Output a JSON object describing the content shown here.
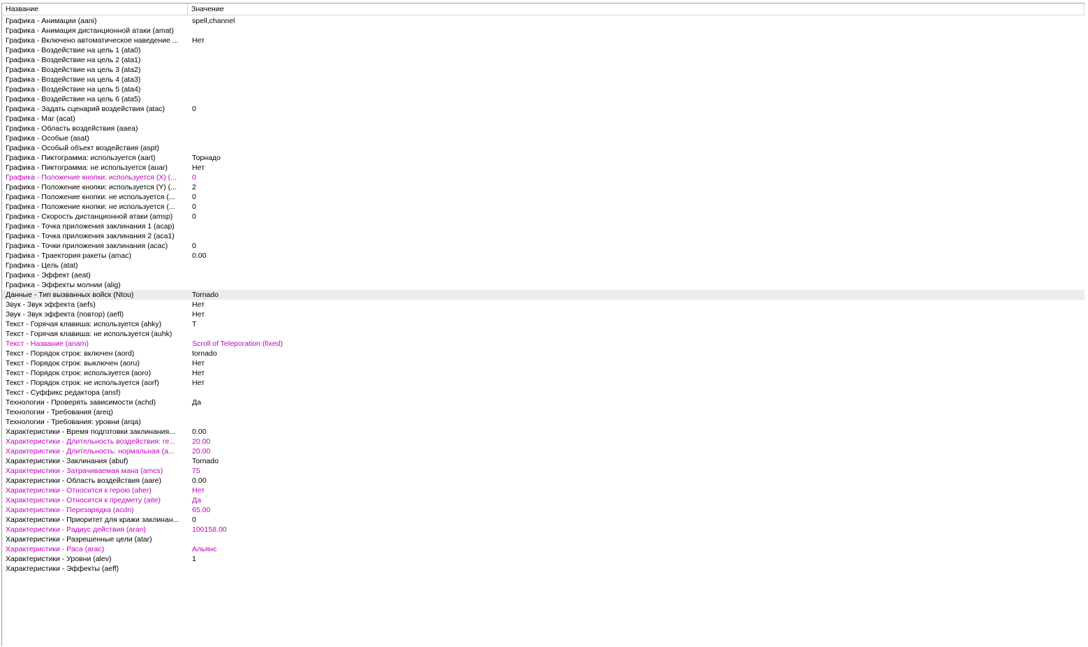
{
  "columns": {
    "name": "Название",
    "value": "Значение"
  },
  "colors": {
    "modified_text": "#c000c0",
    "selected_row_bg": "#ececec"
  },
  "rows": [
    {
      "name": "Графика - Анимации (aani)",
      "value": "spell,channel",
      "modified": false
    },
    {
      "name": "Графика - Анимация дистанционной атаки (amat)",
      "value": "",
      "modified": false
    },
    {
      "name": "Графика - Включено автоматическое наведение ...",
      "value": "Нет",
      "modified": false
    },
    {
      "name": "Графика - Воздействие на цель 1 (ata0)",
      "value": "",
      "modified": false
    },
    {
      "name": "Графика - Воздействие на цель 2 (ata1)",
      "value": "",
      "modified": false
    },
    {
      "name": "Графика - Воздействие на цель 3 (ata2)",
      "value": "",
      "modified": false
    },
    {
      "name": "Графика - Воздействие на цель 4 (ata3)",
      "value": "",
      "modified": false
    },
    {
      "name": "Графика - Воздействие на цель 5 (ata4)",
      "value": "",
      "modified": false
    },
    {
      "name": "Графика - Воздействие на цель 6 (ata5)",
      "value": "",
      "modified": false
    },
    {
      "name": "Графика - Задать сценарий воздействия (atac)",
      "value": "0",
      "modified": false
    },
    {
      "name": "Графика - Маг (acat)",
      "value": "",
      "modified": false
    },
    {
      "name": "Графика - Область воздействия (aaea)",
      "value": "",
      "modified": false
    },
    {
      "name": "Графика - Особые (asat)",
      "value": "",
      "modified": false
    },
    {
      "name": "Графика - Особый объект воздействия (aspt)",
      "value": "",
      "modified": false
    },
    {
      "name": "Графика - Пиктограмма: используется (aart)",
      "value": "Торнадо",
      "modified": false
    },
    {
      "name": "Графика - Пиктограмма: не используется (auar)",
      "value": "Нет",
      "modified": false
    },
    {
      "name": "Графика - Положение кнопки: используется (X) (...",
      "value": "0",
      "modified": true
    },
    {
      "name": "Графика - Положение кнопки: используется (Y) (...",
      "value": "2",
      "modified": false
    },
    {
      "name": "Графика - Положение кнопки: не используется (...",
      "value": "0",
      "modified": false
    },
    {
      "name": "Графика - Положение кнопки: не используется (...",
      "value": "0",
      "modified": false
    },
    {
      "name": "Графика - Скорость дистанционной атаки (amsp)",
      "value": "0",
      "modified": false
    },
    {
      "name": "Графика - Точка приложения заклинания 1 (acap)",
      "value": "",
      "modified": false
    },
    {
      "name": "Графика - Точка приложения заклинания 2 (aca1)",
      "value": "",
      "modified": false
    },
    {
      "name": "Графика - Точки приложения заклинания (acac)",
      "value": "0",
      "modified": false
    },
    {
      "name": "Графика - Траектория ракеты (amac)",
      "value": "0.00",
      "modified": false
    },
    {
      "name": "Графика - Цель (atat)",
      "value": "",
      "modified": false
    },
    {
      "name": "Графика - Эффект (aeat)",
      "value": "",
      "modified": false
    },
    {
      "name": "Графика - Эффекты молнии (alig)",
      "value": "",
      "modified": false
    },
    {
      "name": "Данные - Тип вызванных войск (Ntou)",
      "value": "Tornado",
      "modified": false,
      "selected": true
    },
    {
      "name": "Звук - Звук эффекта (aefs)",
      "value": "Нет",
      "modified": false
    },
    {
      "name": "Звук - Звук эффекта (повтор) (aefl)",
      "value": "Нет",
      "modified": false
    },
    {
      "name": "Текст - Горячая клавиша: используется (ahky)",
      "value": "T",
      "modified": false
    },
    {
      "name": "Текст - Горячая клавиша: не используется (auhk)",
      "value": "",
      "modified": false
    },
    {
      "name": "Текст - Название (anam)",
      "value": "Scroll of Teleporation (fixed)",
      "modified": true
    },
    {
      "name": "Текст - Порядок строк: включен (aord)",
      "value": "tornado",
      "modified": false
    },
    {
      "name": "Текст - Порядок строк: выключен (aoru)",
      "value": "Нет",
      "modified": false
    },
    {
      "name": "Текст - Порядок строк: используется (aoro)",
      "value": "Нет",
      "modified": false
    },
    {
      "name": "Текст - Порядок строк: не используется (aorf)",
      "value": "Нет",
      "modified": false
    },
    {
      "name": "Текст - Суффикс редактора (ansf)",
      "value": "",
      "modified": false
    },
    {
      "name": "Технологии - Проверять зависимости (achd)",
      "value": "Да",
      "modified": false
    },
    {
      "name": "Технологии - Требования (areq)",
      "value": "",
      "modified": false
    },
    {
      "name": "Технологии - Требования: уровни (arqa)",
      "value": "",
      "modified": false
    },
    {
      "name": "Характеристики - Время подготовки заклинания...",
      "value": "0.00",
      "modified": false
    },
    {
      "name": "Характеристики - Длительность воздействия: ге...",
      "value": "20.00",
      "modified": true
    },
    {
      "name": "Характеристики - Длительность: нормальная (a...",
      "value": "20.00",
      "modified": true
    },
    {
      "name": "Характеристики - Заклинания (abuf)",
      "value": "Tornado",
      "modified": false
    },
    {
      "name": "Характеристики - Затрачиваемая мана (amcs)",
      "value": "75",
      "modified": true
    },
    {
      "name": "Характеристики - Область воздействия (aare)",
      "value": "0.00",
      "modified": false
    },
    {
      "name": "Характеристики - Относится к герою (aher)",
      "value": "Нет",
      "modified": true
    },
    {
      "name": "Характеристики - Относится к предмету (aite)",
      "value": "Да",
      "modified": true
    },
    {
      "name": "Характеристики - Перезарядка (acdn)",
      "value": "65.00",
      "modified": true
    },
    {
      "name": "Характеристики - Приоритет для кражи заклинан...",
      "value": "0",
      "modified": false
    },
    {
      "name": "Характеристики - Радиус действия (aran)",
      "value": "100158.00",
      "modified": true
    },
    {
      "name": "Характеристики - Разрешенные цели (atar)",
      "value": "",
      "modified": false
    },
    {
      "name": "Характеристики - Раса (arac)",
      "value": "Альянс",
      "modified": true
    },
    {
      "name": "Характеристики - Уровни (alev)",
      "value": "1",
      "modified": false
    },
    {
      "name": "Характеристики - Эффекты (aeff)",
      "value": "",
      "modified": false
    }
  ]
}
